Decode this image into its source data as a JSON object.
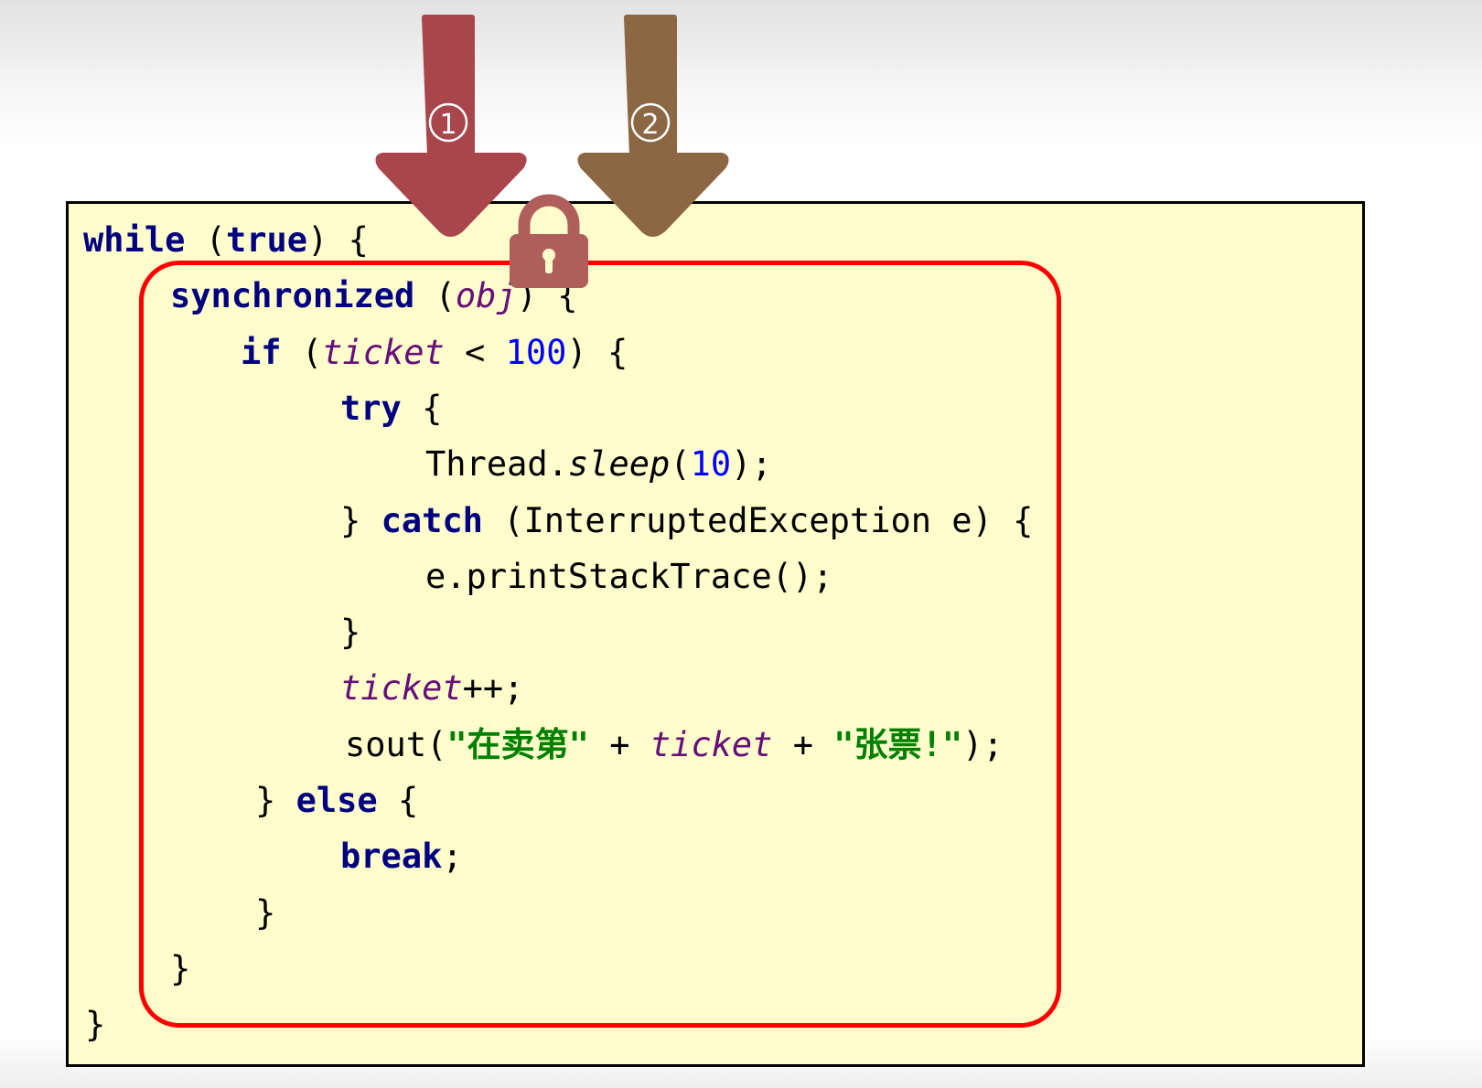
{
  "colors": {
    "arrow_1": "#a8464c",
    "arrow_2": "#8c6744",
    "lock": "#b05e5c",
    "sync_box": "#ff0000",
    "code_bg": "#fffdcc"
  },
  "arrows": [
    {
      "label": "①",
      "icon": "arrow-down-icon"
    },
    {
      "label": "②",
      "icon": "arrow-down-icon"
    }
  ],
  "lock_icon": "lock-icon",
  "code": {
    "lines": [
      [
        {
          "t": "while",
          "c": "kw"
        },
        {
          "t": " ("
        },
        {
          "t": "true",
          "c": "kw"
        },
        {
          "t": ") {"
        }
      ],
      [
        {
          "t": "synchronized",
          "c": "kw"
        },
        {
          "t": " ("
        },
        {
          "t": "obj",
          "c": "fld"
        },
        {
          "t": ") {"
        }
      ],
      [
        {
          "t": "if",
          "c": "kw"
        },
        {
          "t": " ("
        },
        {
          "t": "ticket",
          "c": "fld"
        },
        {
          "t": " < "
        },
        {
          "t": "100",
          "c": "num"
        },
        {
          "t": ") {"
        }
      ],
      [
        {
          "t": "try",
          "c": "kw"
        },
        {
          "t": " {"
        }
      ],
      [
        {
          "t": "Thread."
        },
        {
          "t": "sleep",
          "c": "mth"
        },
        {
          "t": "("
        },
        {
          "t": "10",
          "c": "num"
        },
        {
          "t": ");"
        }
      ],
      [
        {
          "t": "} "
        },
        {
          "t": "catch",
          "c": "kw"
        },
        {
          "t": " (InterruptedException e) {"
        }
      ],
      [
        {
          "t": "e.printStackTrace();"
        }
      ],
      [
        {
          "t": "}"
        }
      ],
      [
        {
          "t": "ticket",
          "c": "fld"
        },
        {
          "t": "++;"
        }
      ],
      [
        {
          "t": "sout("
        },
        {
          "t": "\"在卖第\"",
          "c": "str"
        },
        {
          "t": " + "
        },
        {
          "t": "ticket",
          "c": "fld"
        },
        {
          "t": " + "
        },
        {
          "t": "\"张票!\"",
          "c": "str"
        },
        {
          "t": ");"
        }
      ],
      [
        {
          "t": "} "
        },
        {
          "t": "else",
          "c": "kw"
        },
        {
          "t": " {"
        }
      ],
      [
        {
          "t": "break",
          "c": "kw"
        },
        {
          "t": ";"
        }
      ],
      [
        {
          "t": "}"
        }
      ],
      [
        {
          "t": "}"
        }
      ],
      [
        {
          "t": "}"
        }
      ]
    ]
  }
}
